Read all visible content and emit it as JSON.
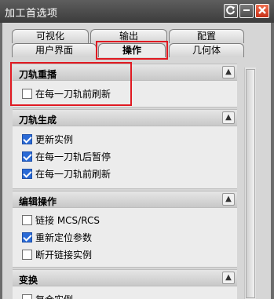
{
  "window": {
    "title": "加工首选项"
  },
  "tabs": {
    "row1": [
      {
        "label": "可视化"
      },
      {
        "label": "输出"
      },
      {
        "label": "配置"
      }
    ],
    "row2": [
      {
        "label": "用户界面"
      },
      {
        "label": "操作",
        "active": true
      },
      {
        "label": "几何体"
      }
    ]
  },
  "sections": [
    {
      "title": "刀轨重播",
      "options": [
        {
          "label": "在每一刀轨前刷新",
          "checked": false
        }
      ]
    },
    {
      "title": "刀轨生成",
      "options": [
        {
          "label": "更新实例",
          "checked": true
        },
        {
          "label": "在每一刀轨后暂停",
          "checked": true
        },
        {
          "label": "在每一刀轨前刷新",
          "checked": true
        }
      ]
    },
    {
      "title": "编辑操作",
      "options": [
        {
          "label": "链接 MCS/RCS",
          "checked": false
        },
        {
          "label": "重新定位参数",
          "checked": true
        },
        {
          "label": "断开链接实例",
          "checked": false
        }
      ]
    },
    {
      "title": "变换",
      "options": [
        {
          "label": "复合实例",
          "checked": false
        }
      ]
    }
  ],
  "icons": {
    "collapse": "chevron-up-icon",
    "reset": "reset-icon",
    "minimize": "minimize-icon",
    "close": "close-icon"
  },
  "colors": {
    "highlight": "#e01a22",
    "checkbox_checked": "#2a6ad6"
  }
}
